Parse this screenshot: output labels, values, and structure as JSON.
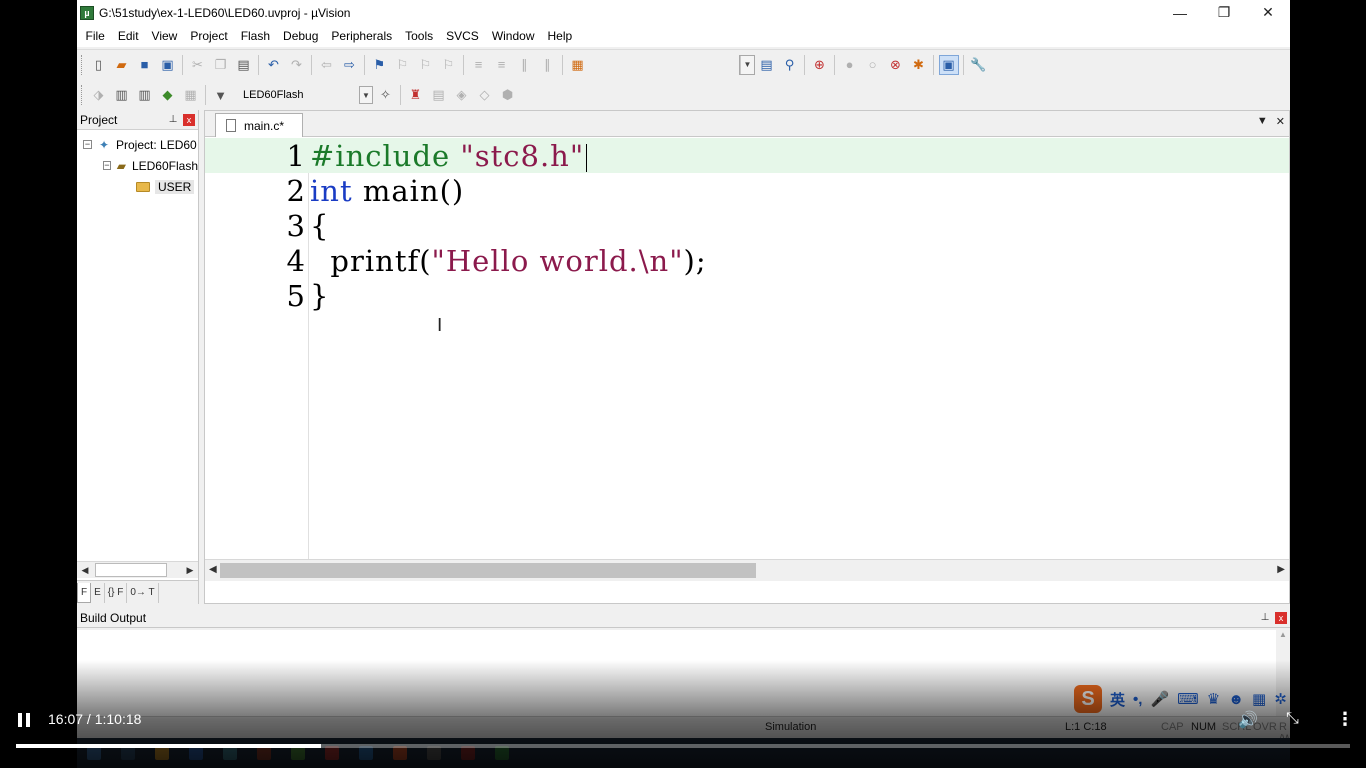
{
  "window": {
    "title": "G:\\51study\\ex-1-LED60\\LED60.uvproj - µVision",
    "minimize": "—",
    "restore": "❐",
    "close": "✕"
  },
  "menu": [
    "File",
    "Edit",
    "View",
    "Project",
    "Flash",
    "Debug",
    "Peripherals",
    "Tools",
    "SVCS",
    "Window",
    "Help"
  ],
  "toolbar2": {
    "target": "LED60Flash"
  },
  "project_panel": {
    "title": "Project",
    "pin": "⊥",
    "close": "x",
    "tree": {
      "root": "Project: LED60",
      "target": "LED60Flash",
      "group": "USER"
    },
    "tabs": [
      "F",
      "E",
      "{} F",
      "0→ T"
    ]
  },
  "editor": {
    "tab_label": "main.c*",
    "lines": [
      {
        "num": "1",
        "parts": [
          {
            "t": "#include ",
            "c": "kw-pre"
          },
          {
            "t": "\"stc8.h\"",
            "c": "kw-str"
          }
        ]
      },
      {
        "num": "2",
        "parts": [
          {
            "t": "int",
            "c": "kw-blue"
          },
          {
            "t": " main()",
            "c": "kw-fn"
          }
        ]
      },
      {
        "num": "3",
        "parts": [
          {
            "t": "{",
            "c": "kw-fn"
          }
        ]
      },
      {
        "num": "4",
        "parts": [
          {
            "t": "  printf(",
            "c": "kw-fn"
          },
          {
            "t": "\"Hello world.\\n\"",
            "c": "kw-str"
          },
          {
            "t": ");",
            "c": "kw-fn"
          }
        ]
      },
      {
        "num": "5",
        "parts": [
          {
            "t": "}",
            "c": "kw-fn"
          }
        ]
      }
    ]
  },
  "build_output": {
    "title": "Build Output"
  },
  "status": {
    "mode": "Simulation",
    "position": "L:1 C:18",
    "caps": "CAP",
    "num": "NUM",
    "scrl": "SCRL",
    "ovr": "OVR",
    "rw": "R /W"
  },
  "video": {
    "time": "16:07 / 1:10:18",
    "progress_fraction": 0.229
  },
  "ime": {
    "logo": "S",
    "lang": "英"
  },
  "colors": {
    "current_line": "#e6f7e9",
    "preprocessor": "#1b7a2a",
    "keyword": "#1a3cc4",
    "string": "#8b1a4c"
  }
}
